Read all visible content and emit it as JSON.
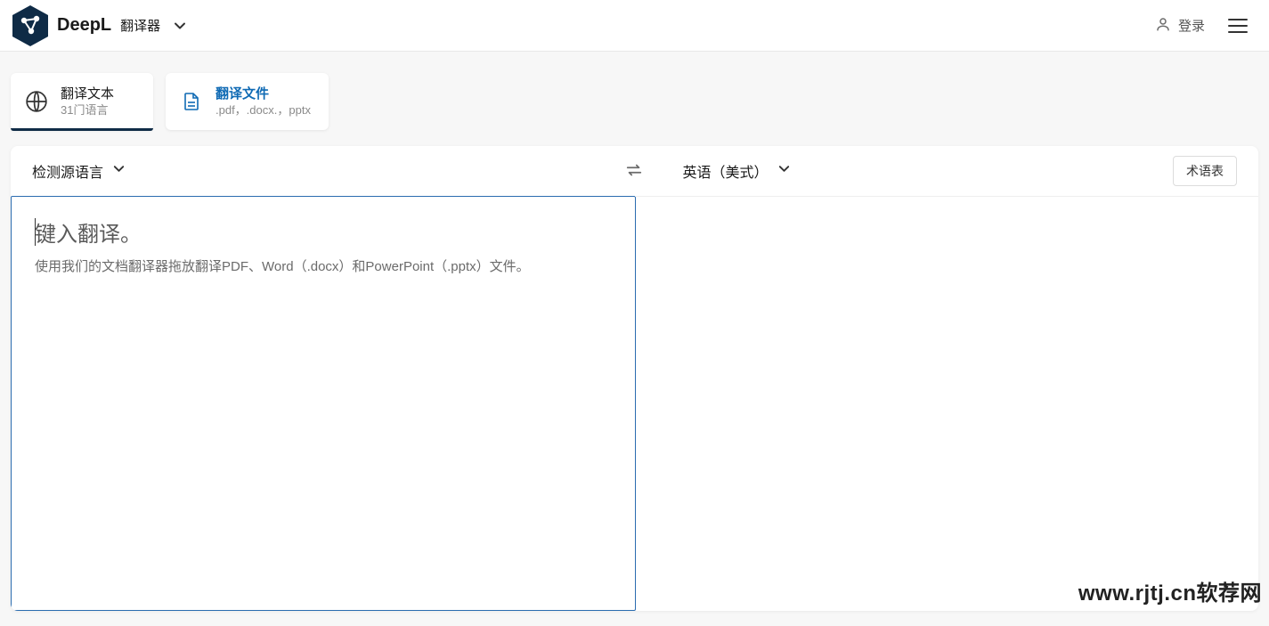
{
  "header": {
    "brand": "DeepL",
    "brand_sub": "翻译器",
    "login_label": "登录"
  },
  "tabs": [
    {
      "title": "翻译文本",
      "sub": "31门语言",
      "active": true
    },
    {
      "title": "翻译文件",
      "sub": ".pdf，.docx.，pptx",
      "active": false
    }
  ],
  "lang": {
    "source": "检测源语言",
    "target": "英语（美式）",
    "glossary": "术语表"
  },
  "editor": {
    "placeholder_main": "键入翻译。",
    "placeholder_sub": "使用我们的文档翻译器拖放翻译PDF、Word（.docx）和PowerPoint（.pptx）文件。"
  },
  "watermark": "www.rjtj.cn软荐网"
}
